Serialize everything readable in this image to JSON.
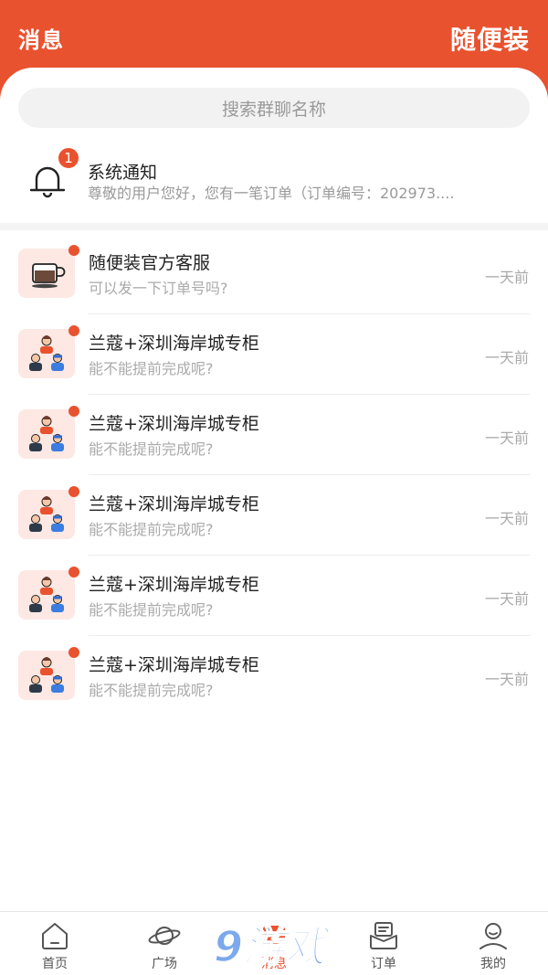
{
  "header": {
    "title": "消息",
    "brand": "随便装"
  },
  "search": {
    "placeholder": "搜索群聊名称"
  },
  "notice": {
    "title": "系统通知",
    "text": "尊敬的用户您好，您有一笔订单（订单编号：202973....",
    "badge": "1"
  },
  "conversations": [
    {
      "name": "随便装官方客服",
      "message": "可以发一下订单号吗?",
      "time": "一天前",
      "avatar": "coffee-cup-icon"
    },
    {
      "name": "兰蔻+深圳海岸城专柜",
      "message": "能不能提前完成呢?",
      "time": "一天前",
      "avatar": "group-people-icon"
    },
    {
      "name": "兰蔻+深圳海岸城专柜",
      "message": "能不能提前完成呢?",
      "time": "一天前",
      "avatar": "group-people-icon"
    },
    {
      "name": "兰蔻+深圳海岸城专柜",
      "message": "能不能提前完成呢?",
      "time": "一天前",
      "avatar": "group-people-icon"
    },
    {
      "name": "兰蔻+深圳海岸城专柜",
      "message": "能不能提前完成呢?",
      "time": "一天前",
      "avatar": "group-people-icon"
    },
    {
      "name": "兰蔻+深圳海岸城专柜",
      "message": "能不能提前完成呢?",
      "time": "一天前",
      "avatar": "group-people-icon"
    }
  ],
  "tabs": [
    {
      "label": "首页",
      "icon": "home-icon"
    },
    {
      "label": "广场",
      "icon": "planet-icon"
    },
    {
      "label": "消息",
      "icon": "message-icon"
    },
    {
      "label": "订单",
      "icon": "order-icon"
    },
    {
      "label": "我的",
      "icon": "profile-icon"
    }
  ],
  "watermark": {
    "text": "9游戏"
  },
  "colors": {
    "accent": "#e9522f",
    "muted": "#aaaaaa"
  }
}
